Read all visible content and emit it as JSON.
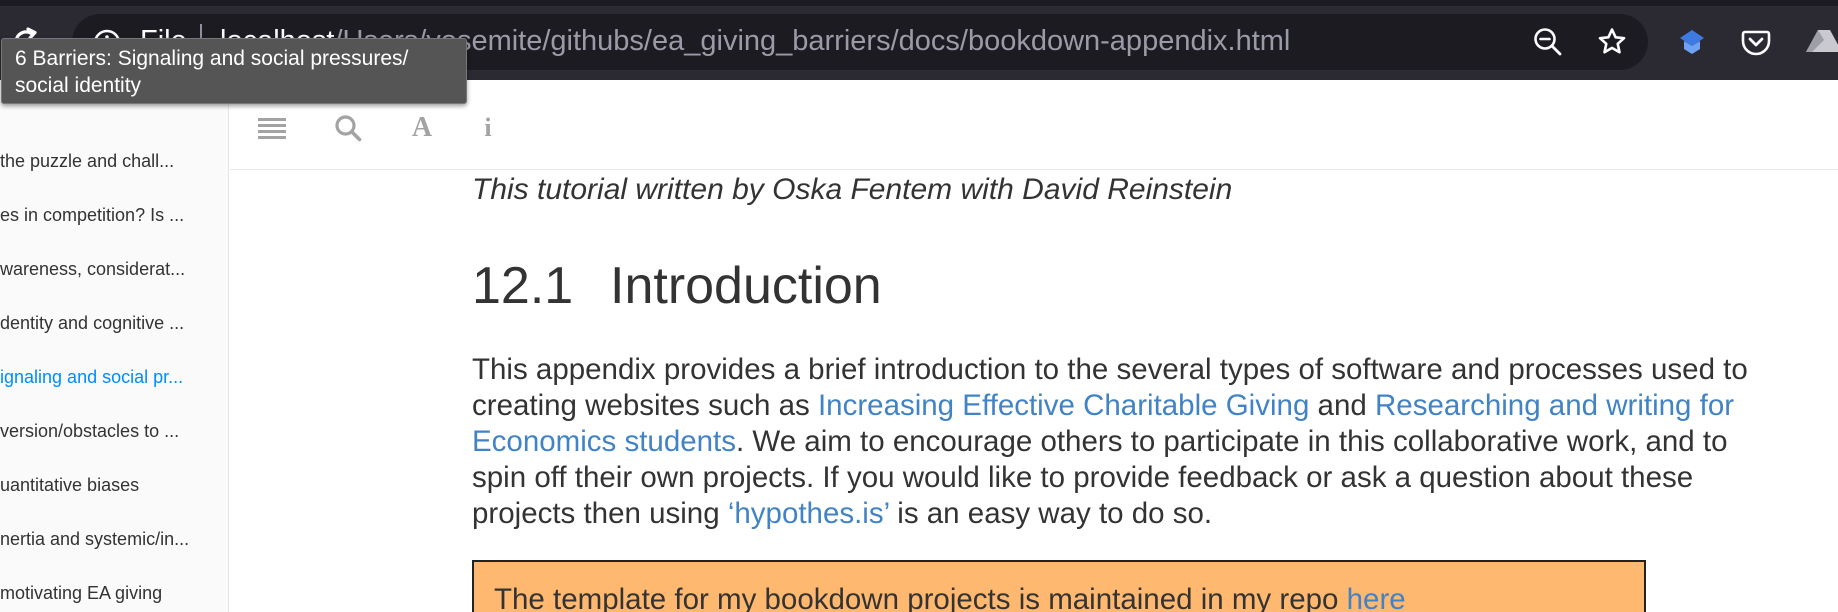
{
  "browser": {
    "file_label": "File",
    "url_host": "localhost",
    "url_path": "/Users/yosemite/githubs/ea_giving_barriers/docs/bookdown-appendix.html",
    "icons": [
      "reload-icon",
      "info-icon",
      "zoom-out-icon",
      "star-icon",
      "extension-icon",
      "pocket-icon",
      "drive-icon"
    ]
  },
  "tooltip": {
    "line1": "6 Barriers: Signaling and social pressures/",
    "line2": "social identity"
  },
  "sidebar": {
    "items": [
      {
        "label": "the puzzle and chall..."
      },
      {
        "label": "es in competition? Is ..."
      },
      {
        "label": "wareness, considerat..."
      },
      {
        "label": "dentity and cognitive ..."
      },
      {
        "label": "ignaling and social pr...",
        "active": true
      },
      {
        "label": "version/obstacles to ..."
      },
      {
        "label": "uantitative biases"
      },
      {
        "label": "nertia and systemic/in..."
      },
      {
        "label": "motivating EA giving"
      }
    ]
  },
  "toolbar": {
    "icons": [
      "toc-toggle-icon",
      "search-icon",
      "font-settings-icon",
      "info-icon"
    ],
    "font_glyph": "A",
    "info_glyph": "i"
  },
  "content": {
    "byline": "This tutorial written by Oska Fentem with David Reinstein",
    "section_number": "12.1",
    "section_title": "Introduction",
    "para_1": "This appendix provides a brief introduction to the several types of software and processes used to creating websites such as ",
    "link_1": "Increasing Effective Charitable Giving",
    "para_2": " and ",
    "link_2": "Researching and writing for Economics students",
    "para_3": ". We aim to encourage others to participate in this collaborative work, and to spin off their own projects. If you would like to provide feedback or ask a question about these projects then using ",
    "link_3": "‘hypothes.is’",
    "para_4": " is an easy way to do so.",
    "callout_text": "The template for my bookdown projects is maintained in my repo ",
    "callout_link": "here"
  },
  "colors": {
    "chrome_bg": "#2b2a33",
    "link": "#4183c4",
    "toc_active": "#008cff",
    "callout_bg": "#ffb870"
  }
}
